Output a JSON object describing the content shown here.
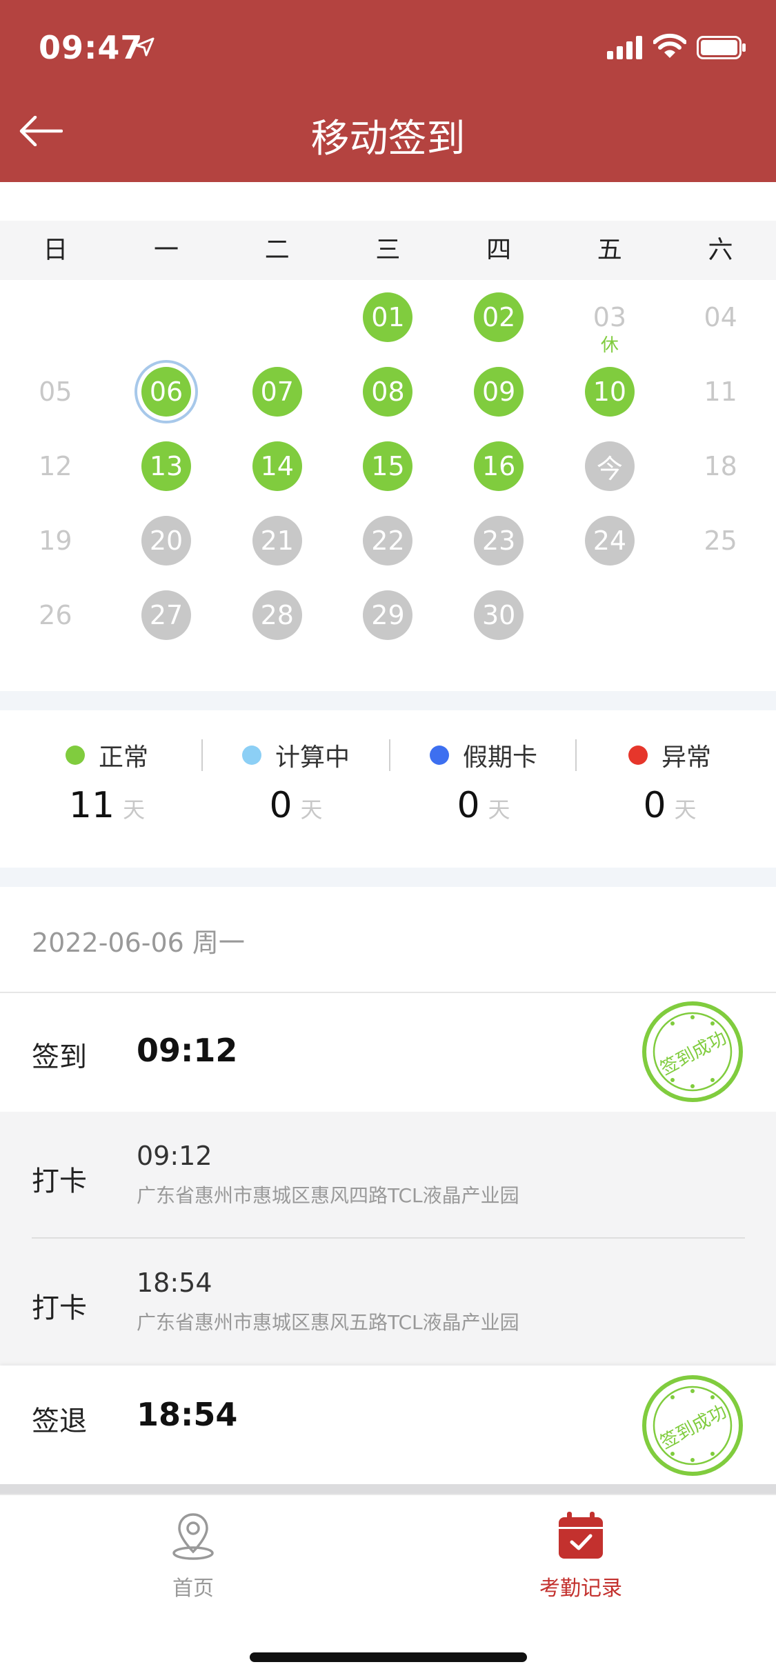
{
  "status_bar": {
    "time": "09:47"
  },
  "header": {
    "title": "移动签到"
  },
  "calendar": {
    "weekdays": [
      "日",
      "一",
      "二",
      "三",
      "四",
      "五",
      "六"
    ],
    "weeks": [
      [
        {
          "d": ""
        },
        {
          "d": ""
        },
        {
          "d": ""
        },
        {
          "d": "01",
          "s": "green"
        },
        {
          "d": "02",
          "s": "green"
        },
        {
          "d": "03",
          "s": "plain",
          "note": "休"
        },
        {
          "d": "04",
          "s": "plain"
        }
      ],
      [
        {
          "d": "05",
          "s": "plain"
        },
        {
          "d": "06",
          "s": "green",
          "selected": true
        },
        {
          "d": "07",
          "s": "green"
        },
        {
          "d": "08",
          "s": "green"
        },
        {
          "d": "09",
          "s": "green"
        },
        {
          "d": "10",
          "s": "green"
        },
        {
          "d": "11",
          "s": "plain"
        }
      ],
      [
        {
          "d": "12",
          "s": "plain"
        },
        {
          "d": "13",
          "s": "green"
        },
        {
          "d": "14",
          "s": "green"
        },
        {
          "d": "15",
          "s": "green"
        },
        {
          "d": "16",
          "s": "green"
        },
        {
          "d": "今",
          "s": "gray"
        },
        {
          "d": "18",
          "s": "plain"
        }
      ],
      [
        {
          "d": "19",
          "s": "plain"
        },
        {
          "d": "20",
          "s": "gray"
        },
        {
          "d": "21",
          "s": "gray"
        },
        {
          "d": "22",
          "s": "gray"
        },
        {
          "d": "23",
          "s": "gray"
        },
        {
          "d": "24",
          "s": "gray"
        },
        {
          "d": "25",
          "s": "plain"
        }
      ],
      [
        {
          "d": "26",
          "s": "plain"
        },
        {
          "d": "27",
          "s": "gray"
        },
        {
          "d": "28",
          "s": "gray"
        },
        {
          "d": "29",
          "s": "gray"
        },
        {
          "d": "30",
          "s": "gray"
        },
        {
          "d": ""
        },
        {
          "d": ""
        }
      ]
    ]
  },
  "legend": {
    "unit": "天",
    "items": [
      {
        "label": "正常",
        "value": "11",
        "color": "#80cc3e"
      },
      {
        "label": "计算中",
        "value": "0",
        "color": "#8ccff5"
      },
      {
        "label": "假期卡",
        "value": "0",
        "color": "#3d6ff0"
      },
      {
        "label": "异常",
        "value": "0",
        "color": "#e6362b"
      }
    ]
  },
  "record": {
    "date": "2022-06-06 周一",
    "checkin": {
      "label": "签到",
      "time": "09:12",
      "stamp": "签到成功"
    },
    "punches": [
      {
        "label": "打卡",
        "time": "09:12",
        "address": "广东省惠州市惠城区惠风四路TCL液晶产业园"
      },
      {
        "label": "打卡",
        "time": "18:54",
        "address": "广东省惠州市惠城区惠风五路TCL液晶产业园"
      }
    ],
    "checkout": {
      "label": "签退",
      "time": "18:54",
      "stamp": "签到成功"
    }
  },
  "nav": {
    "home": {
      "label": "首页"
    },
    "attendance": {
      "label": "考勤记录"
    },
    "active_color": "#c3312e",
    "inactive_color": "#999999"
  }
}
